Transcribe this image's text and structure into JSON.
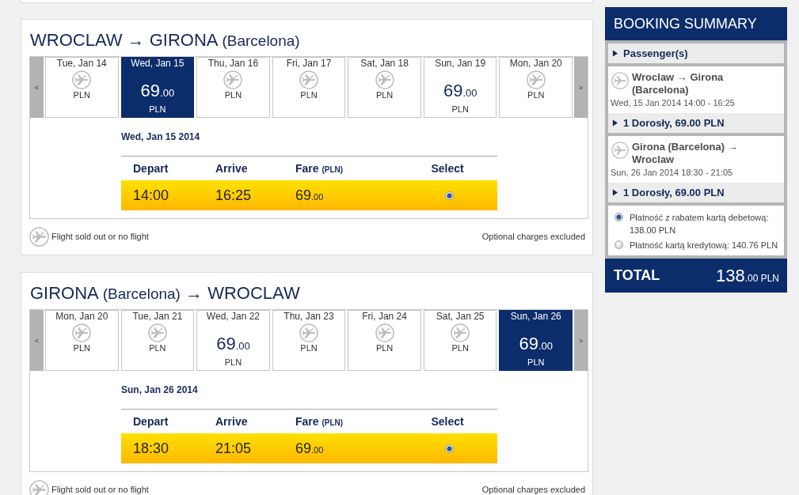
{
  "journeys": [
    {
      "title": [
        {
          "text": "WROCLAW → GIRONA",
          "kind": "city"
        },
        {
          "text": "(Barcelona)",
          "kind": "note"
        }
      ],
      "prev_button": "<",
      "next_button": ">",
      "days": [
        {
          "label": "Tue, Jan 14",
          "kind": "sold_out",
          "currency": "PLN",
          "selected": false
        },
        {
          "label": "Wed, Jan 15",
          "kind": "fare",
          "price": "69",
          "cents": ".00",
          "currency": "PLN",
          "selected": true
        },
        {
          "label": "Thu, Jan 16",
          "kind": "sold_out",
          "currency": "PLN",
          "selected": false
        },
        {
          "label": "Fri, Jan 17",
          "kind": "sold_out",
          "currency": "PLN",
          "selected": false
        },
        {
          "label": "Sat, Jan 18",
          "kind": "sold_out",
          "currency": "PLN",
          "selected": false
        },
        {
          "label": "Sun, Jan 19",
          "kind": "fare",
          "price": "69",
          "cents": ".00",
          "currency": "PLN",
          "selected": false
        },
        {
          "label": "Mon, Jan 20",
          "kind": "sold_out",
          "currency": "PLN",
          "selected": false
        }
      ],
      "date_heading": "Wed, Jan 15 2014",
      "columns": [
        {
          "label": "Depart"
        },
        {
          "label": "Arrive"
        },
        {
          "label": "Fare",
          "unit": "(PLN)"
        },
        {
          "label": "Select"
        }
      ],
      "flights": [
        {
          "depart": "14:00",
          "arrive": "16:25",
          "fare": "69",
          "fare_cents": ".00",
          "selected": true
        }
      ],
      "legend": "Flight sold out or no flight",
      "note": "Optional charges excluded"
    },
    {
      "title": [
        {
          "text": "GIRONA",
          "kind": "city"
        },
        {
          "text": "(Barcelona)",
          "kind": "note"
        },
        {
          "text": "→ WROCLAW",
          "kind": "city"
        }
      ],
      "prev_button": "<",
      "next_button": ">",
      "days": [
        {
          "label": "Mon, Jan 20",
          "kind": "sold_out",
          "currency": "PLN",
          "selected": false
        },
        {
          "label": "Tue, Jan 21",
          "kind": "sold_out",
          "currency": "PLN",
          "selected": false
        },
        {
          "label": "Wed, Jan 22",
          "kind": "fare",
          "price": "69",
          "cents": ".00",
          "currency": "PLN",
          "selected": false
        },
        {
          "label": "Thu, Jan 23",
          "kind": "sold_out",
          "currency": "PLN",
          "selected": false
        },
        {
          "label": "Fri, Jan 24",
          "kind": "sold_out",
          "currency": "PLN",
          "selected": false
        },
        {
          "label": "Sat, Jan 25",
          "kind": "sold_out",
          "currency": "PLN",
          "selected": false
        },
        {
          "label": "Sun, Jan 26",
          "kind": "fare",
          "price": "69",
          "cents": ".00",
          "currency": "PLN",
          "selected": true
        }
      ],
      "date_heading": "Sun, Jan 26 2014",
      "columns": [
        {
          "label": "Depart"
        },
        {
          "label": "Arrive"
        },
        {
          "label": "Fare",
          "unit": "(PLN)"
        },
        {
          "label": "Select"
        }
      ],
      "flights": [
        {
          "depart": "18:30",
          "arrive": "21:05",
          "fare": "69",
          "fare_cents": ".00",
          "selected": true
        }
      ],
      "legend": "Flight sold out or no flight",
      "note": "Optional charges excluded"
    }
  ],
  "booking_summary": {
    "title": "BOOKING SUMMARY",
    "passengers": {
      "label": "Passenger(s)",
      "expanded": false
    },
    "segments": [
      {
        "route": "Wroclaw → Girona (Barcelona)",
        "when": "Wed, 15 Jan 2014 14:00 - 16:25",
        "fare_line": {
          "label": "1 Dorosły, 69.00 PLN",
          "expanded": false
        }
      },
      {
        "route": "Girona (Barcelona) → Wroclaw",
        "when": "Sun, 26 Jan 2014 18:30 - 21:05",
        "fare_line": {
          "label": "1 Dorosły, 69.00 PLN",
          "expanded": false
        }
      }
    ],
    "payment_options": [
      {
        "label": "Płatność z rabatem kartą debetową: 138.00 PLN",
        "selected": true
      },
      {
        "label": "Płatność kartą kredytową: 140.76 PLN",
        "selected": false
      }
    ],
    "total": {
      "label": "TOTAL",
      "amount": "138",
      "cents": ".00",
      "currency": "PLN"
    }
  }
}
